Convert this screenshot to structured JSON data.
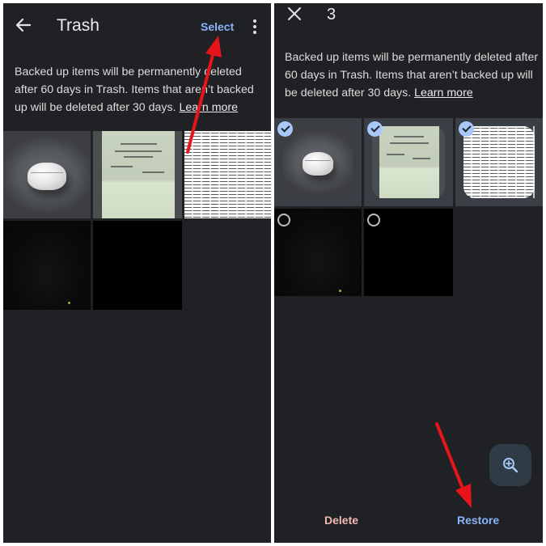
{
  "left_screen": {
    "header": {
      "title": "Trash",
      "select_label": "Select",
      "back_icon": "arrow-left-icon",
      "more_icon": "more-vertical-icon"
    },
    "info": {
      "text": "Backed up items will be permanently deleted after 60 days in Trash. Items that aren’t backed up will be deleted after 30 days.",
      "link": "Learn more"
    },
    "photos": [
      {
        "subject": "earbuds-case"
      },
      {
        "subject": "document-paper"
      },
      {
        "subject": "text-document"
      },
      {
        "subject": "dark-photo"
      },
      {
        "subject": "black-photo"
      }
    ]
  },
  "right_screen": {
    "header": {
      "close_icon": "close-icon",
      "selected_count": "3"
    },
    "info": {
      "text": "Backed up items will be permanently deleted after 60 days in Trash. Items that aren’t backed up will be deleted after 30 days.",
      "link": "Learn more"
    },
    "photos": [
      {
        "subject": "earbuds-case",
        "selected": true
      },
      {
        "subject": "document-paper",
        "selected": true
      },
      {
        "subject": "text-document",
        "selected": true
      },
      {
        "subject": "dark-photo",
        "selected": false
      },
      {
        "subject": "black-photo",
        "selected": false
      }
    ],
    "actions": {
      "delete_label": "Delete",
      "restore_label": "Restore"
    },
    "fab_icon": "zoom-in-icon"
  },
  "annotations": {
    "arrow_color": "#e8141b"
  },
  "colors": {
    "background": "#1f2124",
    "accent_blue": "#8ab4f8",
    "delete_pink": "#f2b8b5",
    "check_blue": "#a8c7fa"
  }
}
